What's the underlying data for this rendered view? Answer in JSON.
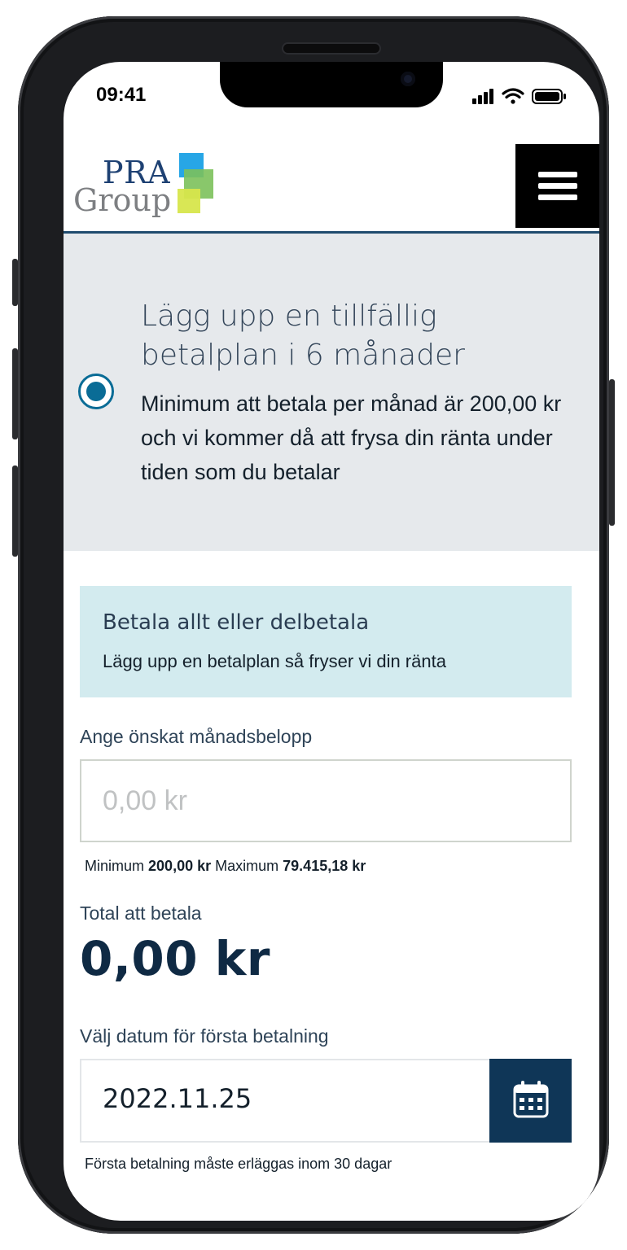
{
  "status_bar": {
    "time": "09:41"
  },
  "header": {
    "logo_line1": "PRA",
    "logo_line2": "Group",
    "menu_icon": "hamburger-menu-icon"
  },
  "plan_option": {
    "title": "Lägg upp en tillfällig betalplan i 6 månader",
    "description_lines": [
      "Minimum att betala per månad är 200,00 kr",
      "och vi kommer då att frysa din ränta under",
      "tiden som du betalar"
    ],
    "selected": true
  },
  "info_box": {
    "title": "Betala allt eller delbetala",
    "subtitle": "Lägg upp en betalplan så fryser vi din ränta"
  },
  "amount": {
    "label": "Ange önskat månadsbelopp",
    "placeholder": "0,00 kr",
    "min_label": "Minimum",
    "min_value": "200,00 kr",
    "max_label": "Maximum",
    "max_value": "79.415,18 kr"
  },
  "total": {
    "label": "Total att betala",
    "value": "0,00 kr"
  },
  "first_payment": {
    "label": "Välj datum för första betalning",
    "date": "2022.11.25",
    "icon": "calendar-icon",
    "note": "Första betalning måste erläggas inom 30 dagar"
  },
  "colors": {
    "brand_navy": "#0f3657",
    "radio_blue": "#0a6c96",
    "info_bg": "#d3ebef",
    "panel_bg": "#e6e9ec"
  }
}
